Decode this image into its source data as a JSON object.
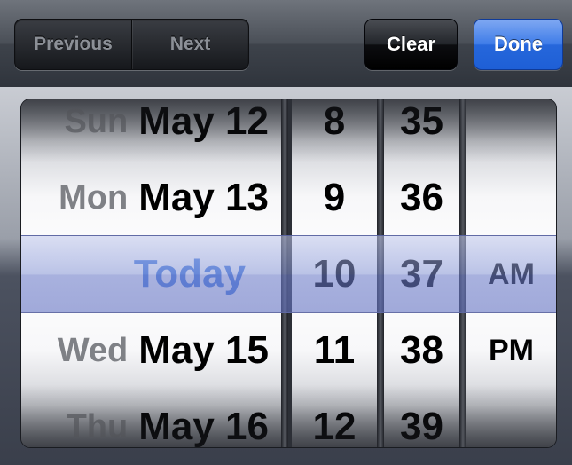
{
  "toolbar": {
    "previous_label": "Previous",
    "next_label": "Next",
    "clear_label": "Clear",
    "done_label": "Done"
  },
  "picker": {
    "date_wheel": [
      {
        "day": "Sun",
        "date": "May 12"
      },
      {
        "day": "Mon",
        "date": "May 13"
      },
      {
        "day": "",
        "date": "Today",
        "selected": true
      },
      {
        "day": "Wed",
        "date": "May 15"
      },
      {
        "day": "Thu",
        "date": "May 16"
      }
    ],
    "hour_wheel": [
      "8",
      "9",
      "10",
      "11",
      "12"
    ],
    "minute_wheel": [
      "35",
      "36",
      "37",
      "38",
      "39"
    ],
    "ampm_wheel": [
      "",
      "",
      "AM",
      "PM",
      ""
    ],
    "selected": {
      "date": "Today",
      "hour": "10",
      "minute": "37",
      "ampm": "AM"
    }
  },
  "colors": {
    "done_button": "#2a6ae0",
    "today_text": "#4a7fe0",
    "selection_bar": "#8791d2"
  }
}
